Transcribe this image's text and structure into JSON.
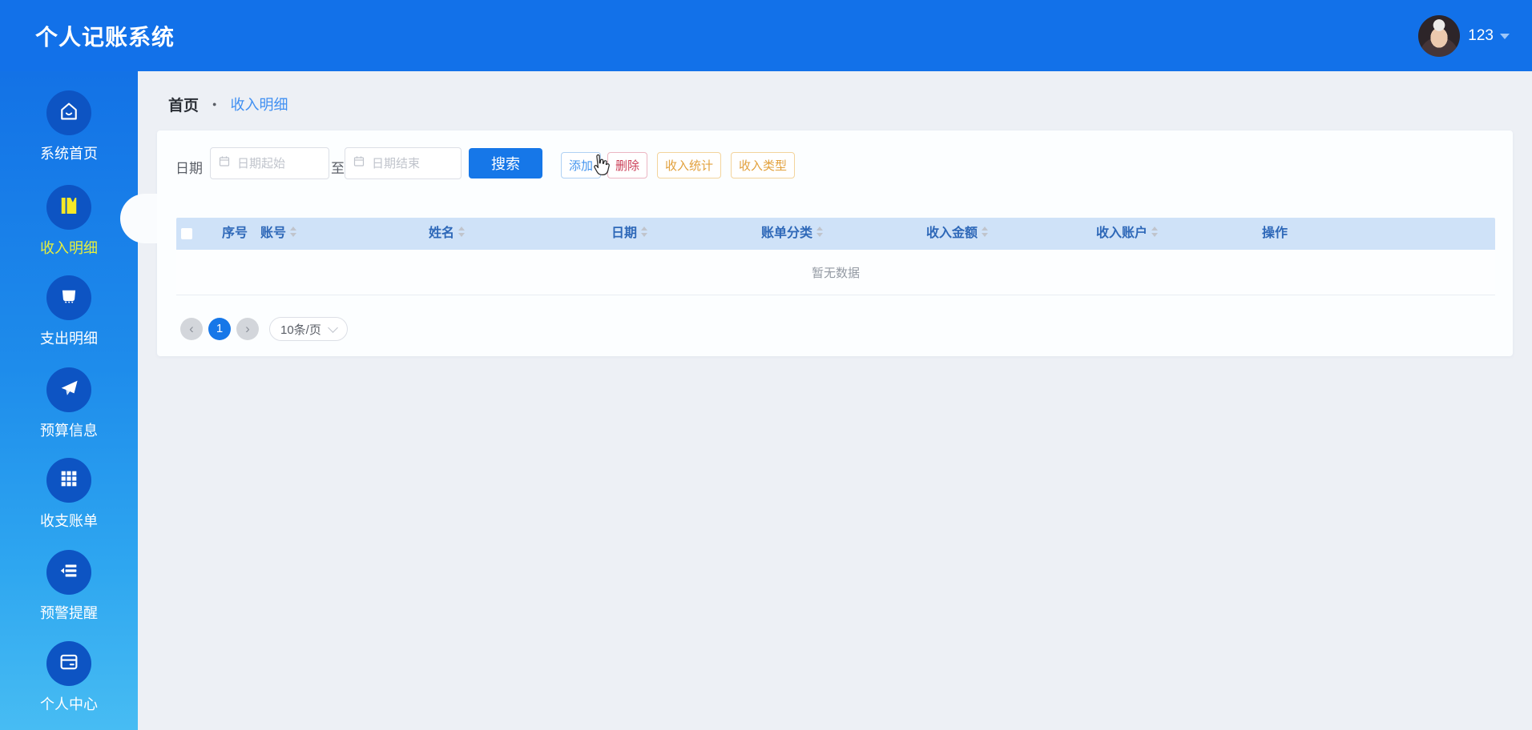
{
  "header": {
    "title": "个人记账系统",
    "user": {
      "name": "123"
    }
  },
  "sidebar": {
    "items": [
      {
        "label": "系统首页",
        "icon": "home",
        "active": false
      },
      {
        "label": "收入明细",
        "icon": "ledger",
        "active": true
      },
      {
        "label": "支出明细",
        "icon": "wallet",
        "active": false
      },
      {
        "label": "预算信息",
        "icon": "paper-plane",
        "active": false
      },
      {
        "label": "收支账单",
        "icon": "grid",
        "active": false
      },
      {
        "label": "预警提醒",
        "icon": "list-arrow",
        "active": false
      },
      {
        "label": "个人中心",
        "icon": "bill-card",
        "active": false
      }
    ]
  },
  "breadcrumb": {
    "home": "首页",
    "separator": "●",
    "current": "收入明细"
  },
  "filters": {
    "date_label": "日期",
    "start_placeholder": "日期起始",
    "to_label": "至",
    "end_placeholder": "日期结束",
    "search_label": "搜索"
  },
  "actions": [
    {
      "label": "添加",
      "type": "primary"
    },
    {
      "label": "删除",
      "type": "danger"
    },
    {
      "label": "收入统计",
      "type": "warning"
    },
    {
      "label": "收入类型",
      "type": "warning"
    }
  ],
  "table": {
    "columns": [
      {
        "label": "序号",
        "sortable": false
      },
      {
        "label": "账号",
        "sortable": true
      },
      {
        "label": "姓名",
        "sortable": true
      },
      {
        "label": "日期",
        "sortable": true
      },
      {
        "label": "账单分类",
        "sortable": true
      },
      {
        "label": "收入金额",
        "sortable": true
      },
      {
        "label": "收入账户",
        "sortable": true
      },
      {
        "label": "操作",
        "sortable": false
      }
    ],
    "empty_text": "暂无数据"
  },
  "pagination": {
    "prev": "‹",
    "page": "1",
    "next": "›",
    "page_size": "10条/页"
  },
  "colors": {
    "accent": "#1677e8",
    "header_blue": "#1271e9",
    "sidebar_gradient_top": "#1372e6",
    "sidebar_gradient_bottom": "#47bcf3",
    "sidebar_bubble": "#0d54c3",
    "active_item_yellow": "#e8f03c",
    "table_header_bg": "#cfe2f8",
    "table_header_text": "#2e68b8",
    "danger_text": "#cb3f58",
    "warning_text": "#e2a13d",
    "muted_text": "#949aa3"
  }
}
